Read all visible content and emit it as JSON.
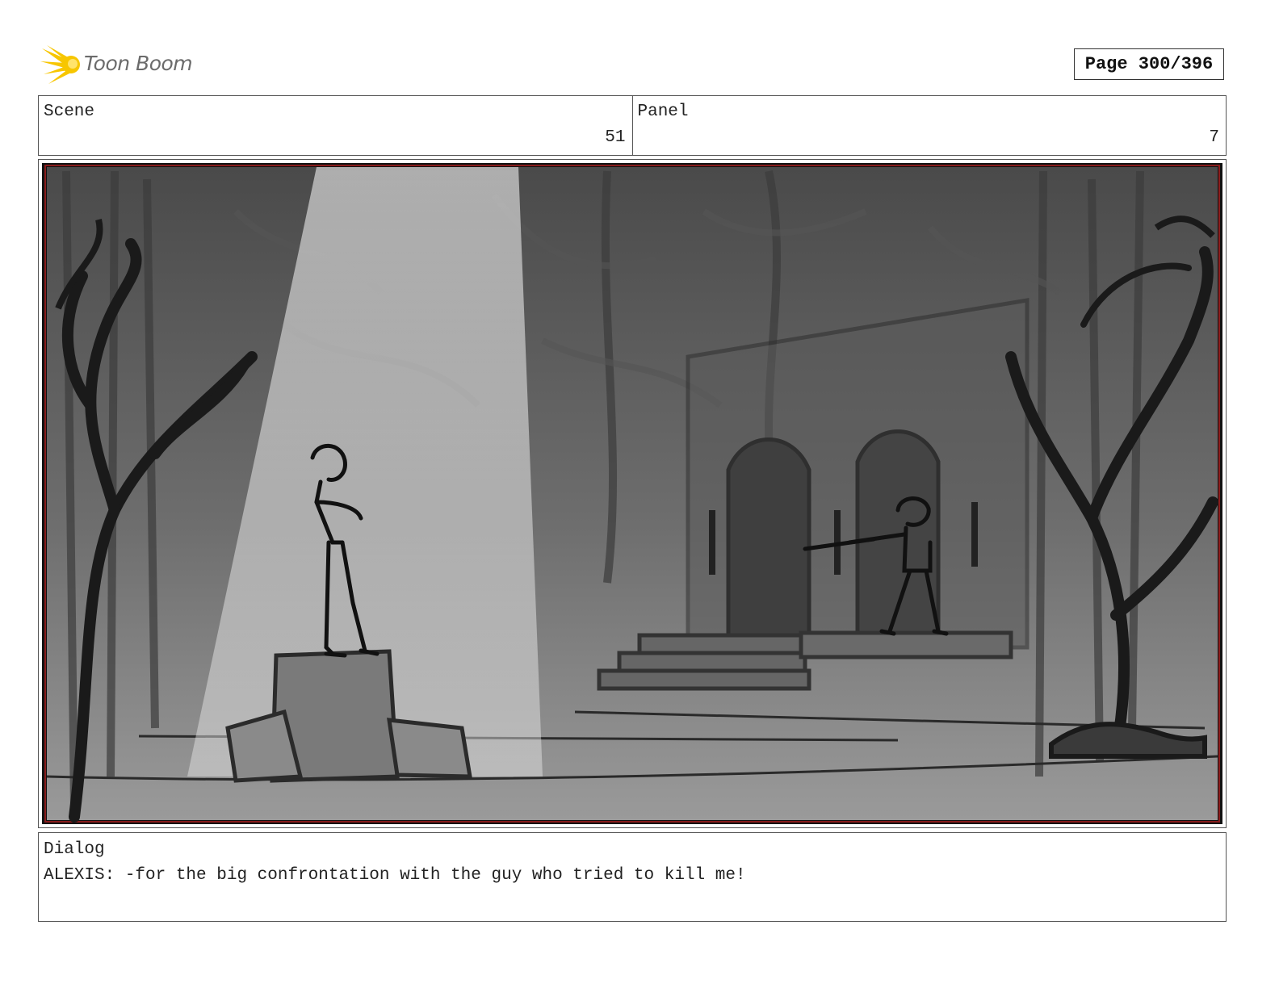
{
  "header": {
    "logo": {
      "text": "Toon Boom",
      "icon": "sparkle-logo-icon",
      "color": "#f5c400"
    },
    "page_indicator": "Page 300/396"
  },
  "info": {
    "scene_label": "Scene",
    "scene_value": "51",
    "panel_label": "Panel",
    "panel_value": "7"
  },
  "panel_image": {
    "description_icon": "storyboard-sketch-image",
    "border_color": "#8a1c1c"
  },
  "dialog": {
    "label": "Dialog",
    "text": "ALEXIS: -for the big confrontation with the guy who tried to kill me!"
  }
}
